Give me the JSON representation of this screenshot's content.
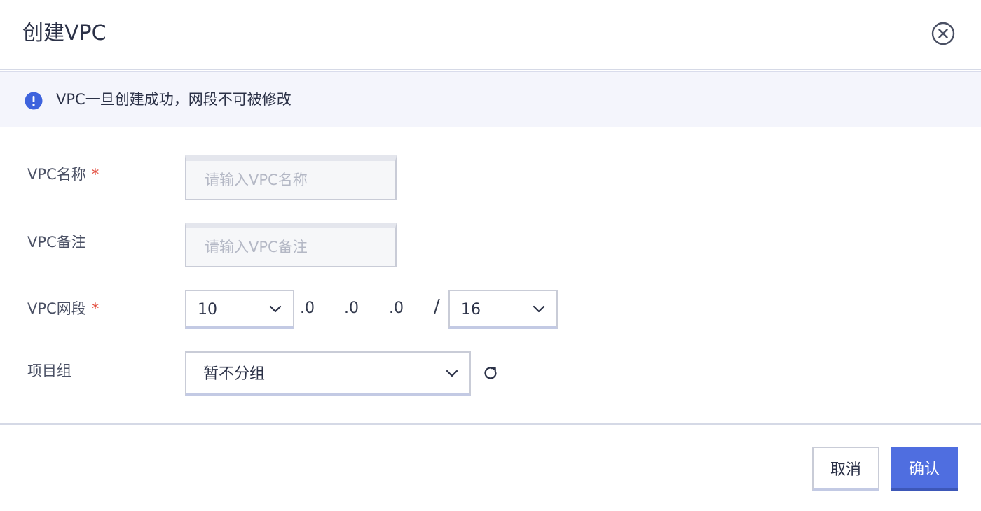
{
  "dialog": {
    "title": "创建VPC"
  },
  "alert": {
    "text": "VPC一旦创建成功，网段不可被修改"
  },
  "form": {
    "name": {
      "label": "VPC名称",
      "required_mark": "*",
      "placeholder": "请输入VPC名称",
      "value": ""
    },
    "remark": {
      "label": "VPC备注",
      "placeholder": "请输入VPC备注",
      "value": ""
    },
    "cidr": {
      "label": "VPC网段",
      "required_mark": "*",
      "first_octet": "10",
      "octet2": ".0",
      "octet3": ".0",
      "octet4": ".0",
      "slash": "/",
      "mask": "16"
    },
    "project_group": {
      "label": "项目组",
      "value": "暂不分组"
    }
  },
  "footer": {
    "cancel_label": "取消",
    "confirm_label": "确认"
  },
  "colors": {
    "primary": "#4f6ee0",
    "info_icon": "#3e63dd",
    "required": "#e24a3b"
  },
  "icons": {
    "close": "close-circle-icon",
    "info": "info-circle-icon",
    "chevron": "chevron-down-icon",
    "refresh": "refresh-icon"
  }
}
